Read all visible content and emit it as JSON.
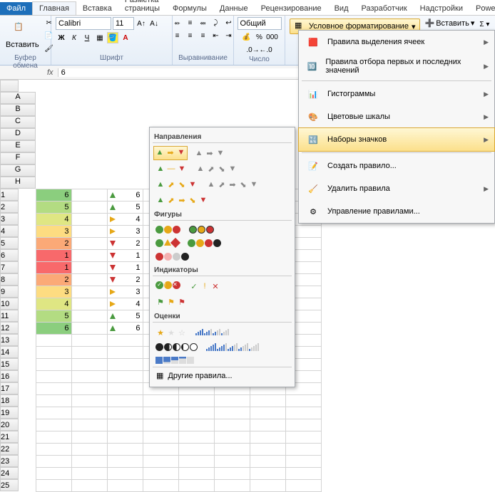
{
  "tabs": {
    "file": "Файл",
    "items": [
      "Главная",
      "Вставка",
      "Разметка страницы",
      "Формулы",
      "Данные",
      "Рецензирование",
      "Вид",
      "Разработчик",
      "Надстройки",
      "PowerP"
    ]
  },
  "ribbon": {
    "clipboard": {
      "paste": "Вставить",
      "label": "Буфер обмена"
    },
    "font": {
      "name": "Calibri",
      "size": "11",
      "label": "Шрифт"
    },
    "alignment": {
      "label": "Выравнивание"
    },
    "number": {
      "format": "Общий",
      "label": "Число"
    },
    "styles": {
      "cf": "Условное форматирование"
    },
    "cells": {
      "insert": "Вставить"
    }
  },
  "formula": {
    "fx": "fx",
    "value": "6"
  },
  "columns": [
    "A",
    "B",
    "C",
    "D",
    "E",
    "F",
    "G",
    "H"
  ],
  "rows": [
    {
      "n": 1,
      "a": 6,
      "c": 6,
      "cls": "cs1",
      "arr": "up"
    },
    {
      "n": 2,
      "a": 5,
      "c": 5,
      "cls": "cs2",
      "arr": "up"
    },
    {
      "n": 3,
      "a": 4,
      "c": 4,
      "cls": "cs3",
      "arr": "side"
    },
    {
      "n": 4,
      "a": 3,
      "c": 3,
      "cls": "cs4",
      "arr": "side"
    },
    {
      "n": 5,
      "a": 2,
      "c": 2,
      "cls": "cs5",
      "arr": "down"
    },
    {
      "n": 6,
      "a": 1,
      "c": 1,
      "cls": "cs6",
      "arr": "down"
    },
    {
      "n": 7,
      "a": 1,
      "c": 1,
      "cls": "cs6",
      "arr": "down"
    },
    {
      "n": 8,
      "a": 2,
      "c": 2,
      "cls": "cs5",
      "arr": "down"
    },
    {
      "n": 9,
      "a": 3,
      "c": 3,
      "cls": "cs4",
      "arr": "side"
    },
    {
      "n": 10,
      "a": 4,
      "c": 4,
      "cls": "cs3",
      "arr": "side"
    },
    {
      "n": 11,
      "a": 5,
      "c": 5,
      "cls": "cs2",
      "arr": "up"
    },
    {
      "n": 12,
      "a": 6,
      "c": 6,
      "cls": "cs1",
      "arr": "up"
    }
  ],
  "extra_rows": [
    13,
    14,
    15,
    16,
    17,
    18,
    19,
    20,
    21,
    22,
    23,
    24,
    25
  ],
  "dropdown": {
    "highlight": "Правила выделения ячеек",
    "toptop": "Правила отбора первых и последних значений",
    "databars": "Гистограммы",
    "colorscales": "Цветовые шкалы",
    "iconsets": "Наборы значков",
    "new": "Создать правило...",
    "clear": "Удалить правила",
    "manage": "Управление правилами..."
  },
  "iconsets": {
    "cat1": "Направления",
    "cat2": "Фигуры",
    "cat3": "Индикаторы",
    "cat4": "Оценки",
    "footer": "Другие правила..."
  }
}
